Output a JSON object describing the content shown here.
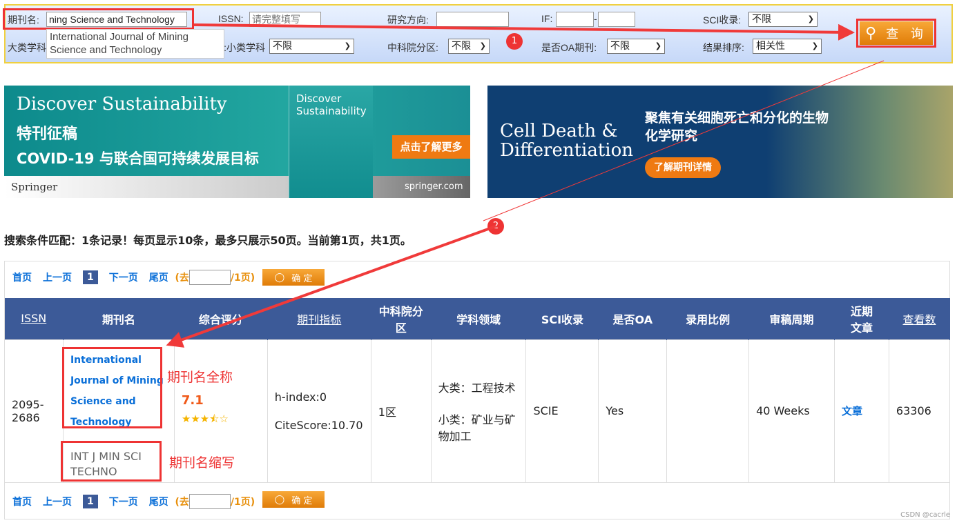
{
  "search": {
    "journal_label": "期刊名:",
    "journal_value": "ning Science and Technology",
    "suggestion": "International Journal of Mining Science and Technology",
    "issn_label": "ISSN:",
    "issn_placeholder": "请完整填写",
    "direction_label": "研究方向:",
    "if_label": "IF:",
    "if_sep": "-",
    "sci_label": "SCI收录:",
    "sci_value": "不限",
    "major_label": "大类学科",
    "minor_label": "小类学科:",
    "minor_value": "不限",
    "cas_label": "中科院分区:",
    "cas_value": "不限",
    "oa_label": "是否OA期刊:",
    "oa_value": "不限",
    "sort_label": "结果排序:",
    "sort_value": "相关性",
    "query_button": "查 询"
  },
  "annotations": {
    "step1": "1",
    "step2": "2",
    "full_name_note": "期刊名全称",
    "abbr_note": "期刊名缩写"
  },
  "banner_left": {
    "title": "Discover Sustainability",
    "line2": "特刊征稿",
    "line3": "COVID-19 与联合国可持续发展目标",
    "cover": "Discover Sustainability",
    "cta": "点击了解更多",
    "publisher": "Springer",
    "site": "springer.com"
  },
  "banner_right": {
    "journal": "Cell Death & Differentiation",
    "headline": "聚焦有关细胞死亡和分化的生物化学研究",
    "cta": "了解期刊详情"
  },
  "summary": "搜索条件匹配：1条记录！每页显示10条，最多只展示50页。当前第1页，共1页。",
  "pager": {
    "first": "首页",
    "prev": "上一页",
    "current": "1",
    "next": "下一页",
    "last": "尾页",
    "goto_prefix": "(去",
    "goto_suffix": "/1页)",
    "ok": "确 定"
  },
  "table": {
    "headers": [
      "ISSN",
      "期刊名",
      "综合评分",
      "期刊指标",
      "中科院分区",
      "学科领域",
      "SCI收录",
      "是否OA",
      "录用比例",
      "审稿周期",
      "近期文章",
      "查看数"
    ],
    "row": {
      "issn": "2095-2686",
      "name_lines": [
        "International",
        "Journal of Mining",
        "Science and",
        "Technology"
      ],
      "abbr": "INT J MIN SCI TECHNO",
      "score": "7.1",
      "stars": 3.5,
      "hindex": "h-index:0",
      "citescore": "CiteScore:10.70",
      "cas": "1区",
      "major": "大类：工程技术",
      "minor": "小类：矿业与矿物加工",
      "sci": "SCIE",
      "oa": "Yes",
      "accept": "",
      "review": "40 Weeks",
      "articles": "文章",
      "views": "63306"
    }
  },
  "watermark": "CSDN @cacrle",
  "colors": {
    "header": "#3c5a98",
    "accent": "#e8900c",
    "annotation": "#e33333",
    "link": "#0a6fd8"
  }
}
